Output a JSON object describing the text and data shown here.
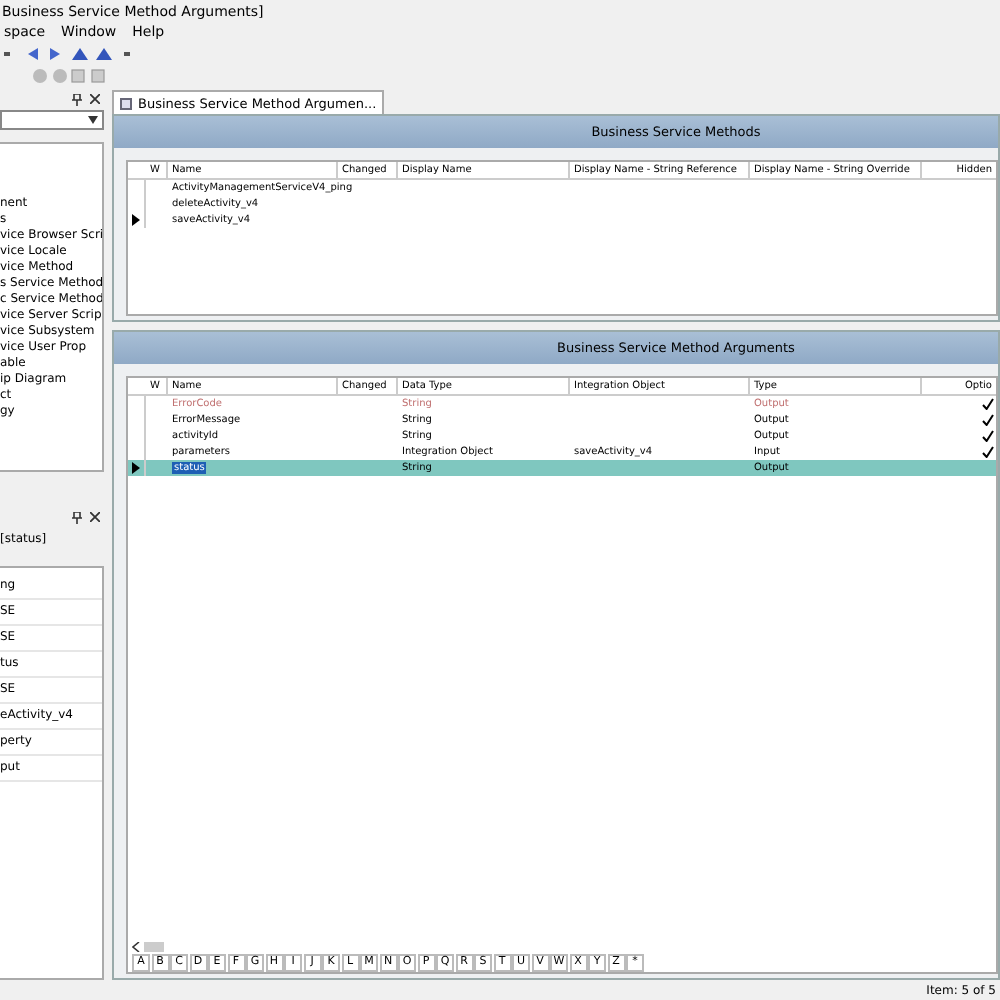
{
  "window": {
    "title": "Business Service Method Arguments]"
  },
  "menu": [
    "space",
    "Window",
    "Help"
  ],
  "left_panel": {
    "tree_items": [
      "nent",
      "s",
      "vice Browser Scri",
      "vice Locale",
      "vice Method",
      "s Service Method",
      "c Service Method",
      "vice Server Scrip",
      "vice Subsystem",
      "vice User Prop",
      "able",
      "ip Diagram",
      "ct",
      "gy"
    ]
  },
  "properties_panel": {
    "title": "[status]",
    "rows": [
      "ng",
      "SE",
      "SE",
      "tus",
      "SE",
      "eActivity_v4",
      "perty",
      "put"
    ]
  },
  "tab": {
    "label": "Business Service Method Argumen...",
    "selected": true
  },
  "methods": {
    "title": "Business Service Methods",
    "columns": [
      "W",
      "Name",
      "Changed",
      "Display Name",
      "Display Name - String Reference",
      "Display Name - String Override",
      "Hidden"
    ],
    "rows": [
      {
        "name": "ActivityManagementServiceV4_ping",
        "selected": false
      },
      {
        "name": "deleteActivity_v4",
        "selected": false
      },
      {
        "name": "saveActivity_v4",
        "selected": true
      }
    ]
  },
  "arguments": {
    "title": "Business Service Method Arguments",
    "columns": [
      "W",
      "Name",
      "Changed",
      "Data Type",
      "Integration Object",
      "Type",
      "Optio"
    ],
    "rows": [
      {
        "name": "ErrorCode",
        "data_type": "String",
        "type": "Output",
        "optional": true,
        "inactive": true,
        "selected": false
      },
      {
        "name": "ErrorMessage",
        "data_type": "String",
        "type": "Output",
        "optional": true,
        "inactive": false,
        "selected": false
      },
      {
        "name": "activityId",
        "data_type": "String",
        "type": "Output",
        "optional": true,
        "inactive": false,
        "selected": false
      },
      {
        "name": "parameters",
        "data_type": "Integration Object",
        "integration_object": "saveActivity_v4",
        "type": "Input",
        "optional": true,
        "inactive": false,
        "selected": false
      },
      {
        "name": "status",
        "data_type": "String",
        "type": "Output",
        "optional": false,
        "inactive": false,
        "selected": true
      }
    ]
  },
  "alphabet": [
    "A",
    "B",
    "C",
    "D",
    "E",
    "F",
    "G",
    "H",
    "I",
    "J",
    "K",
    "L",
    "M",
    "N",
    "O",
    "P",
    "Q",
    "R",
    "S",
    "T",
    "U",
    "V",
    "W",
    "X",
    "Y",
    "Z",
    "*"
  ],
  "status_bar": "Item: 5 of 5"
}
